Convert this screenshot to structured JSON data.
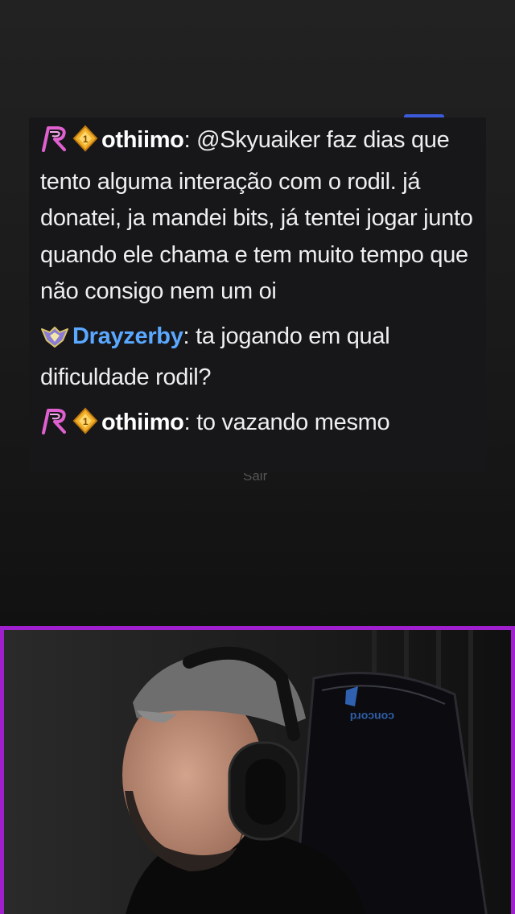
{
  "chat": {
    "messages": [
      {
        "user": "othiimo",
        "text": "@Skyuaiker faz dias que tento alguma interação com o rodil. já donatei, ja mandei bits, já tentei jogar junto quando ele chama e tem muito tempo que não consigo nem um oi"
      },
      {
        "user": "Drayzerby",
        "text": "ta jogando em qual dificuldade rodil?"
      },
      {
        "user": "othiimo",
        "text": "to vazando mesmo"
      }
    ],
    "separator": ": "
  },
  "overlay": {
    "sair_label": "Sair"
  },
  "colors": {
    "frame_border": "#a020d0",
    "drayzerby_name": "#5aa8ff",
    "chat_bg": "#17171a"
  },
  "icons": [
    "pink-r-badge-icon",
    "gold-sub-badge-icon",
    "crest-badge-icon",
    "chair-logo-icon",
    "headphones-icon"
  ],
  "chair_logo_text": "concord"
}
